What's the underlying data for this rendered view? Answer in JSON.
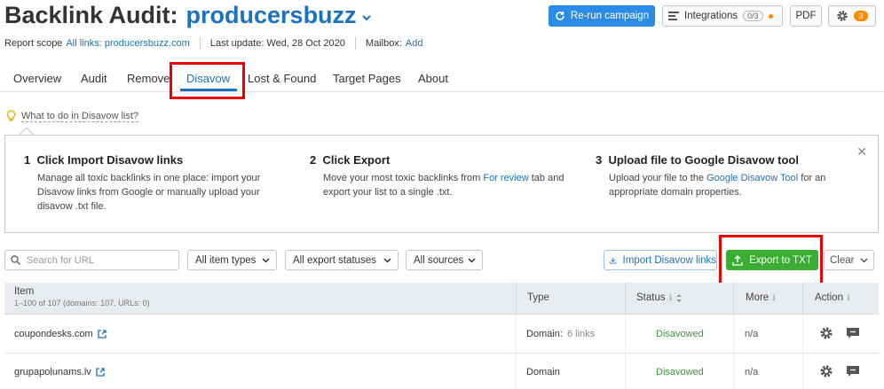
{
  "header": {
    "title": "Backlink Audit:",
    "project": "producersbuzz",
    "rerun_label": "Re-run campaign",
    "integrations_label": "Integrations",
    "integrations_count": "0/3",
    "pdf_label": "PDF",
    "settings_badge": "3"
  },
  "meta": {
    "scope_label": "Report scope",
    "scope_value": "All links: producersbuzz.com",
    "last_update": "Last update: Wed, 28 Oct 2020",
    "mailbox_label": "Mailbox:",
    "mailbox_link": "Add"
  },
  "tabs": [
    {
      "label": "Overview"
    },
    {
      "label": "Audit"
    },
    {
      "label": "Remove"
    },
    {
      "label": "Disavow"
    },
    {
      "label": "Lost & Found"
    },
    {
      "label": "Target Pages"
    },
    {
      "label": "About"
    }
  ],
  "help_link": "What to do in Disavow list?",
  "steps": [
    {
      "number": "1",
      "title": "Click Import Disavow links",
      "line1": "Manage all toxic backlinks in one place: import your",
      "line2": "Disavow links from Google or manually upload your",
      "line3": "disavow .txt file."
    },
    {
      "number": "2",
      "title": "Click Export",
      "pre": "Move your most toxic backlinks from ",
      "link": "For review",
      "post": " tab and",
      "line2": "export your list to a single .txt."
    },
    {
      "number": "3",
      "title": "Upload file to Google Disavow tool",
      "pre": "Upload your file to the ",
      "link": "Google Disavow Tool",
      "post": " for an",
      "line2": "appropriate domain properties."
    }
  ],
  "filters": {
    "search_placeholder": "Search for URL",
    "item_types": "All item types",
    "export_statuses": "All export statuses",
    "sources": "All sources",
    "import_label": "Import Disavow links",
    "export_label": "Export to TXT",
    "clear_label": "Clear"
  },
  "table": {
    "col_item": "Item",
    "col_item_sub": "1–100 of 107 (domains: 107, URLs: 0)",
    "col_type": "Type",
    "col_status": "Status",
    "col_more": "More",
    "col_action": "Action",
    "rows": [
      {
        "item": "coupondesks.com",
        "type": "Domain:",
        "type_extra": "6 links",
        "status": "Disavowed",
        "more": "n/a"
      },
      {
        "item": "grupapolunams.lv",
        "type": "Domain",
        "type_extra": "",
        "status": "Disavowed",
        "more": "n/a"
      }
    ]
  },
  "colors": {
    "accent": "#1a73c0",
    "rerun": "#2b8ce6",
    "export": "#3aad33",
    "highlight": "#e00000",
    "badge": "#ff8a00"
  }
}
